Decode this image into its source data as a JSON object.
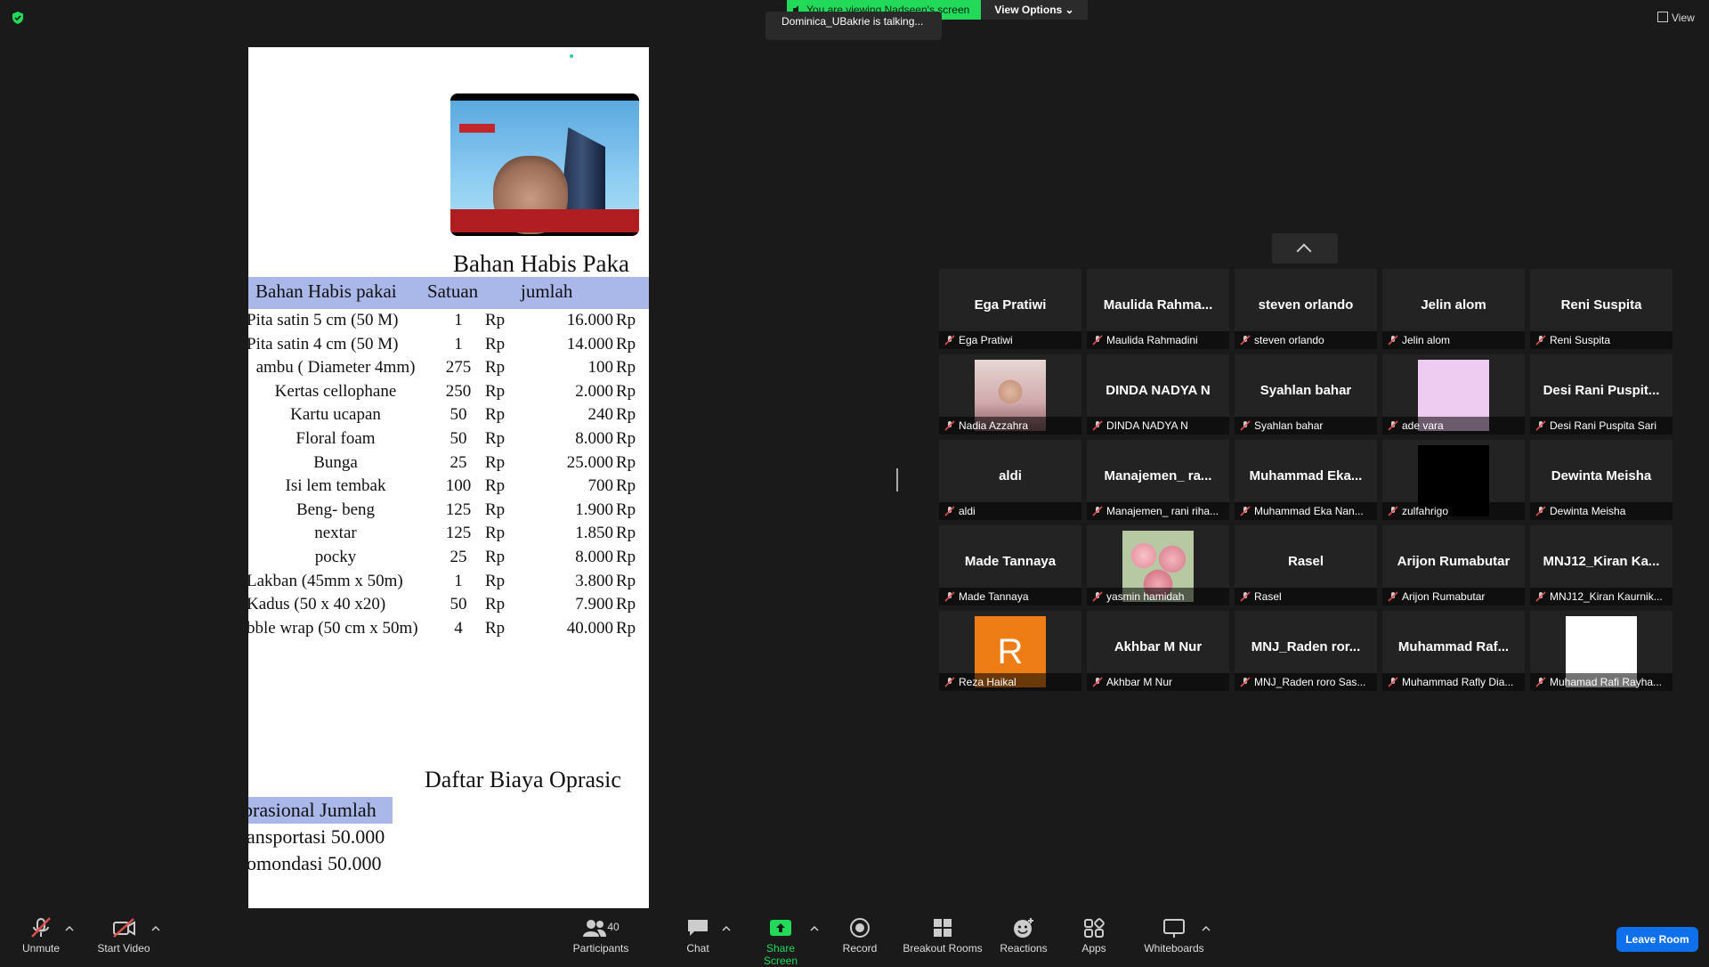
{
  "colors": {
    "background": "#1a1a1a",
    "banner_green": "#23d959",
    "accent_blue": "#0e71eb",
    "muted_red": "#e04b4b",
    "table_header": "#a9b7e9"
  },
  "top": {
    "banner_text": "You are viewing Nadseen's screen",
    "view_options": "View Options",
    "talking": "Dominica_UBakrie is talking...",
    "view": "View"
  },
  "shared_screen": {
    "title1": "Bahan Habis Paka",
    "headers": [
      "Bahan Habis pakai",
      "Satuan",
      "jumlah"
    ],
    "rows": [
      {
        "item": "Pita satin 5 cm (50 M)",
        "qty": "1",
        "cur": "Rp",
        "amount": "16.000",
        "cur2": "Rp"
      },
      {
        "item": "Pita satin 4 cm (50 M)",
        "qty": "1",
        "cur": "Rp",
        "amount": "14.000",
        "cur2": "Rp"
      },
      {
        "item": "ambu ( Diameter 4mm)",
        "qty": "275",
        "cur": "Rp",
        "amount": "100",
        "cur2": "Rp"
      },
      {
        "item": "Kertas cellophane",
        "qty": "250",
        "cur": "Rp",
        "amount": "2.000",
        "cur2": "Rp"
      },
      {
        "item": "Kartu ucapan",
        "qty": "50",
        "cur": "Rp",
        "amount": "240",
        "cur2": "Rp"
      },
      {
        "item": "Floral foam",
        "qty": "50",
        "cur": "Rp",
        "amount": "8.000",
        "cur2": "Rp"
      },
      {
        "item": "Bunga",
        "qty": "25",
        "cur": "Rp",
        "amount": "25.000",
        "cur2": "Rp"
      },
      {
        "item": "Isi lem tembak",
        "qty": "100",
        "cur": "Rp",
        "amount": "700",
        "cur2": "Rp"
      },
      {
        "item": "Beng- beng",
        "qty": "125",
        "cur": "Rp",
        "amount": "1.900",
        "cur2": "Rp"
      },
      {
        "item": "nextar",
        "qty": "125",
        "cur": "Rp",
        "amount": "1.850",
        "cur2": "Rp"
      },
      {
        "item": "pocky",
        "qty": "25",
        "cur": "Rp",
        "amount": "8.000",
        "cur2": "Rp"
      },
      {
        "item": "Lakban (45mm x 50m)",
        "qty": "1",
        "cur": "Rp",
        "amount": "3.800",
        "cur2": "Rp"
      },
      {
        "item": "Kadus (50 x 40 x20)",
        "qty": "50",
        "cur": "Rp",
        "amount": "7.900",
        "cur2": "Rp"
      },
      {
        "item": "bble wrap (50 cm x 50m)",
        "qty": "4",
        "cur": "Rp",
        "amount": "40.000",
        "cur2": "Rp"
      }
    ],
    "title2": "Daftar Biaya Oprasic",
    "op_header": "prasional  Jumlah",
    "op_rows": [
      "ansportasi 50.000",
      "omondasi 50.000"
    ]
  },
  "gallery": {
    "tiles": [
      {
        "big": "Ega Pratiwi",
        "name": "Ega Pratiwi",
        "video": ""
      },
      {
        "big": "Maulida  Rahma...",
        "name": "Maulida Rahmadini",
        "video": ""
      },
      {
        "big": "steven orlando",
        "name": "steven orlando",
        "video": ""
      },
      {
        "big": "Jelin alom",
        "name": "Jelin alom",
        "video": ""
      },
      {
        "big": "Reni Suspita",
        "name": "Reni Suspita",
        "video": ""
      },
      {
        "big": "",
        "name": "Nadia Azzahra",
        "video": "photo-person"
      },
      {
        "big": "DINDA NADYA N",
        "name": "DINDA NADYA N",
        "video": ""
      },
      {
        "big": "Syahlan bahar",
        "name": "Syahlan bahar",
        "video": ""
      },
      {
        "big": "",
        "name": "ade vara",
        "video": "pink"
      },
      {
        "big": "Desi  Rani  Puspit...",
        "name": "Desi Rani Puspita Sari",
        "video": ""
      },
      {
        "big": "aldi",
        "name": "aldi",
        "video": ""
      },
      {
        "big": "Manajemen_  ra...",
        "name": "Manajemen_ rani riha...",
        "video": ""
      },
      {
        "big": "Muhammad  Eka...",
        "name": "Muhammad Eka Nan...",
        "video": ""
      },
      {
        "big": "",
        "name": "zulfahrigo",
        "video": "black"
      },
      {
        "big": "Dewinta Meisha",
        "name": "Dewinta Meisha",
        "video": ""
      },
      {
        "big": "Made Tannaya",
        "name": "Made Tannaya",
        "video": ""
      },
      {
        "big": "",
        "name": "yasmin hamidah",
        "video": "flowers"
      },
      {
        "big": "Rasel",
        "name": "Rasel",
        "video": ""
      },
      {
        "big": "Arijon Rumabutar",
        "name": "Arijon Rumabutar",
        "video": ""
      },
      {
        "big": "MNJ12_Kiran  Ka...",
        "name": "MNJ12_Kiran Kaurnik...",
        "video": ""
      },
      {
        "big": "",
        "name": "Reza Haikal",
        "video": "avatar-R",
        "avatar_letter": "R"
      },
      {
        "big": "Akhbar M Nur",
        "name": "Akhbar M Nur",
        "video": ""
      },
      {
        "big": "MNJ_Raden  ror...",
        "name": "MNJ_Raden roro Sas...",
        "video": ""
      },
      {
        "big": "Muhammad  Raf...",
        "name": "Muhammad Rafly Dia...",
        "video": ""
      },
      {
        "big": "",
        "name": "Muhamad Rafi Rayha...",
        "video": "white"
      }
    ]
  },
  "toolbar": {
    "unmute": "Unmute",
    "start_video": "Start Video",
    "participants": "Participants",
    "participants_count": "40",
    "chat": "Chat",
    "share_screen": "Share Screen",
    "record": "Record",
    "breakout_rooms": "Breakout Rooms",
    "reactions": "Reactions",
    "apps": "Apps",
    "whiteboards": "Whiteboards",
    "leave_room": "Leave Room"
  }
}
